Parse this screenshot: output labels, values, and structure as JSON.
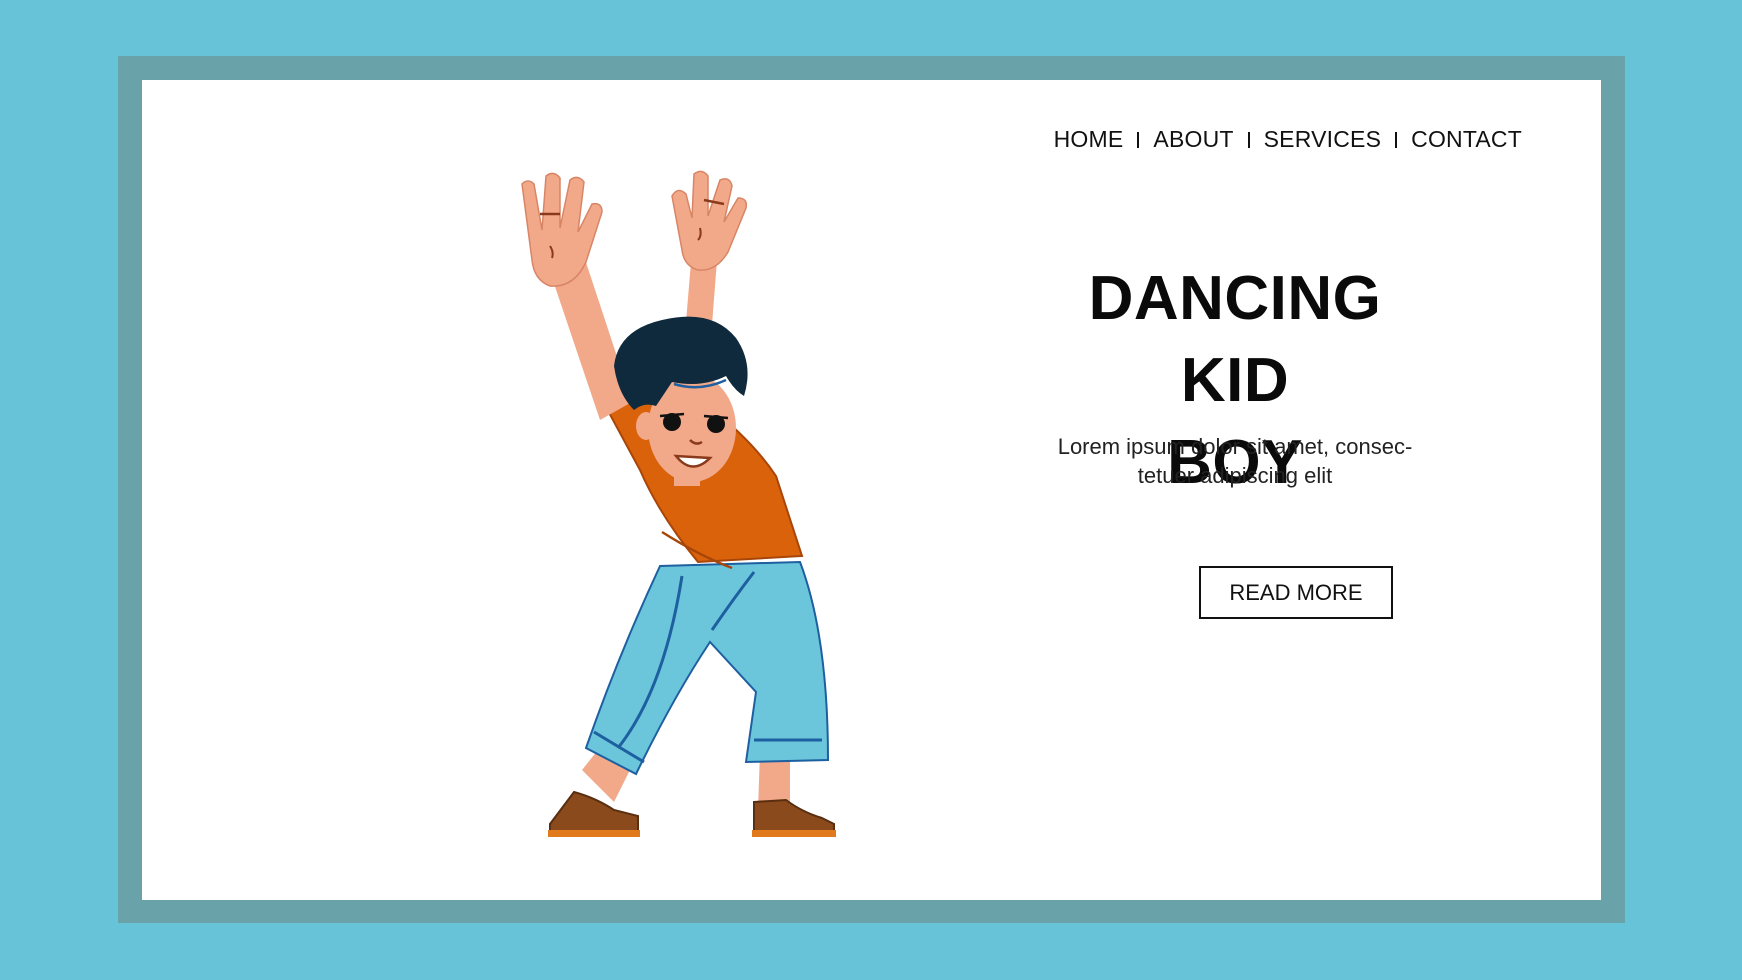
{
  "nav": {
    "items": [
      "HOME",
      "ABOUT",
      "SERVICES",
      "CONTACT"
    ]
  },
  "hero": {
    "title_line1": "DANCING KID",
    "title_line2": "BOY",
    "description_line1": "Lorem ipsum dolor sit amet, consec-",
    "description_line2": "tetuer adipiscing elit",
    "cta_label": "READ MORE"
  },
  "colors": {
    "background": "#67c4d8",
    "frame": "#6aa2aa",
    "card": "#ffffff",
    "shirt": "#d9620a",
    "pants": "#6bc6dc",
    "skin": "#f2a98a",
    "hair": "#0f2a3c",
    "shoes": "#8a4a1c"
  },
  "illustration": {
    "icon": "dancing-boy-illustration"
  }
}
